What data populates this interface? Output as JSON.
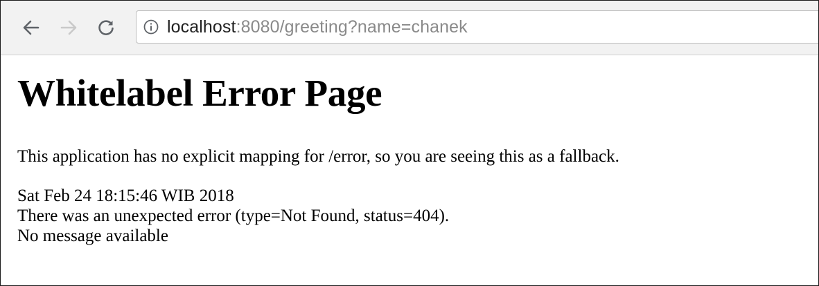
{
  "browser": {
    "url_host": "localhost",
    "url_rest": ":8080/greeting?name=chanek",
    "icons": {
      "back": "arrow-left-icon",
      "forward": "arrow-right-icon",
      "reload": "reload-icon",
      "info": "info-icon"
    }
  },
  "page": {
    "title": "Whitelabel Error Page",
    "message": "This application has no explicit mapping for /error, so you are seeing this as a fallback.",
    "timestamp": "Sat Feb 24 18:15:46 WIB 2018",
    "error_line": "There was an unexpected error (type=Not Found, status=404).",
    "detail": "No message available"
  },
  "colors": {
    "toolbar_bg": "#f2f2f2",
    "url_host": "#222222",
    "url_rest": "#8a8a8a",
    "text": "#000000"
  }
}
